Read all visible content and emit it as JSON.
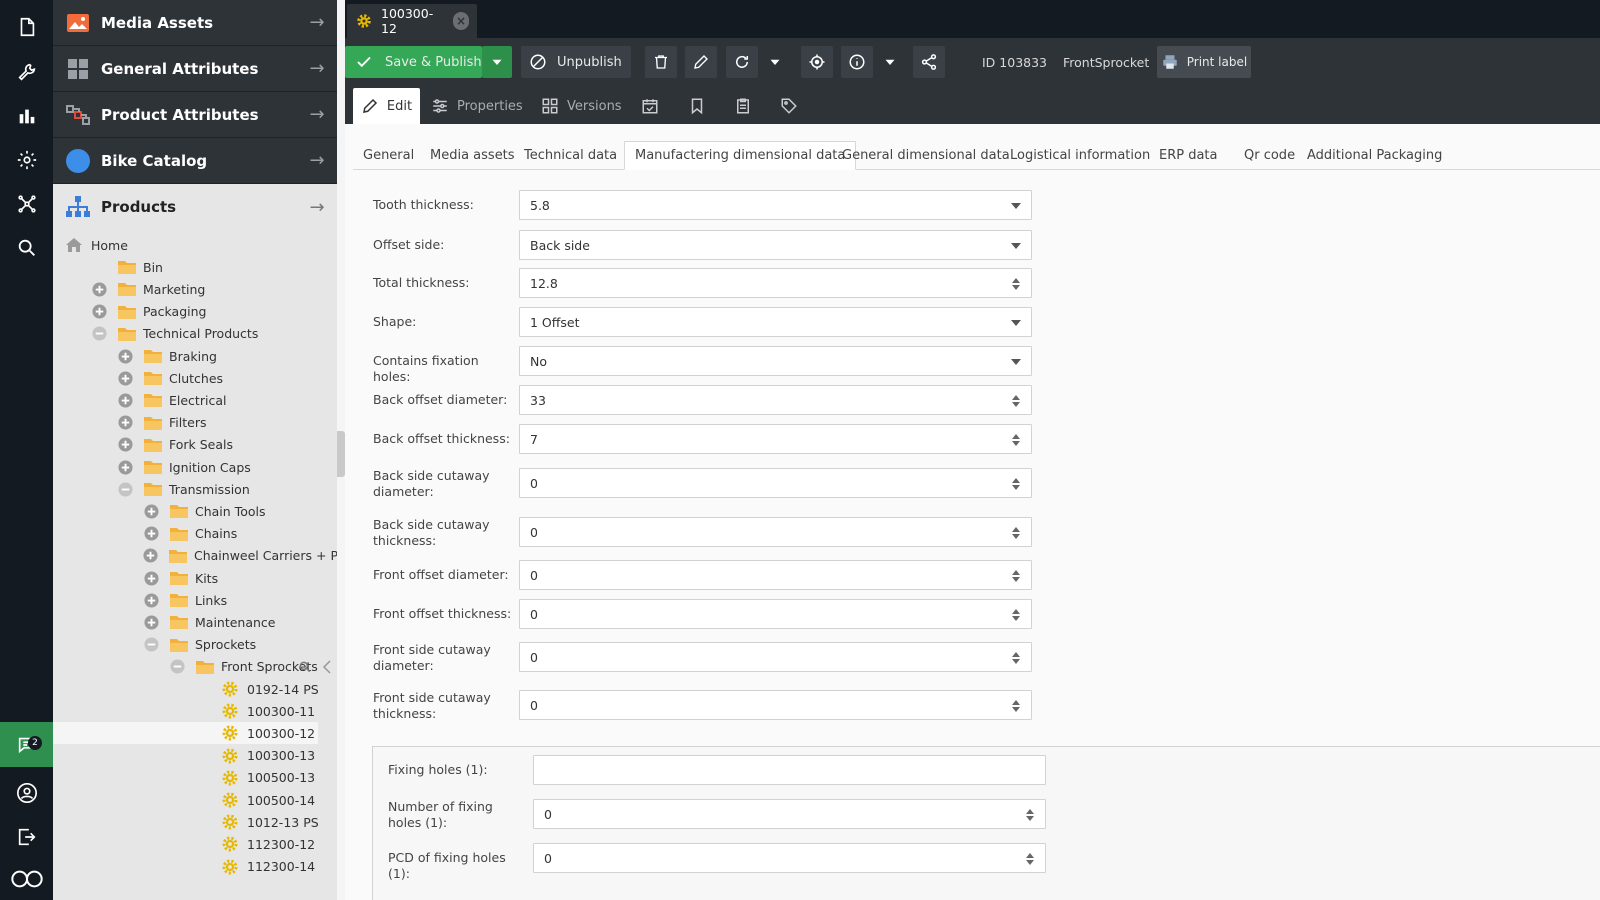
{
  "rail": {
    "chat_badge": "2",
    "icons": [
      "document-icon",
      "wrench-icon",
      "bar-chart-icon",
      "settings-icon",
      "network-icon",
      "search-icon",
      "chat-icon",
      "user-icon",
      "logout-icon",
      "infinity-logo-icon"
    ]
  },
  "nav": {
    "accordions": [
      {
        "label": "Media Assets",
        "icon": "image-icon"
      },
      {
        "label": "General Attributes",
        "icon": "grid-icon"
      },
      {
        "label": "Product Attributes",
        "icon": "attributes-icon"
      },
      {
        "label": "Bike Catalog",
        "icon": "circle-icon"
      },
      {
        "label": "Products",
        "icon": "hierarchy-icon"
      }
    ],
    "tree": [
      {
        "label": "Home",
        "level": 0,
        "type": "home",
        "toggle": "none"
      },
      {
        "label": "Bin",
        "level": 1,
        "type": "folder",
        "toggle": "none"
      },
      {
        "label": "Marketing",
        "level": 1,
        "type": "folder",
        "toggle": "plus"
      },
      {
        "label": "Packaging",
        "level": 1,
        "type": "folder",
        "toggle": "plus"
      },
      {
        "label": "Technical Products",
        "level": 1,
        "type": "folder",
        "toggle": "minus"
      },
      {
        "label": "Braking",
        "level": 2,
        "type": "folder",
        "toggle": "plus"
      },
      {
        "label": "Clutches",
        "level": 2,
        "type": "folder",
        "toggle": "plus"
      },
      {
        "label": "Electrical",
        "level": 2,
        "type": "folder",
        "toggle": "plus"
      },
      {
        "label": "Filters",
        "level": 2,
        "type": "folder",
        "toggle": "plus"
      },
      {
        "label": "Fork Seals",
        "level": 2,
        "type": "folder",
        "toggle": "plus"
      },
      {
        "label": "Ignition Caps",
        "level": 2,
        "type": "folder",
        "toggle": "plus"
      },
      {
        "label": "Transmission",
        "level": 2,
        "type": "folder",
        "toggle": "minus"
      },
      {
        "label": "Chain Tools",
        "level": 3,
        "type": "folder",
        "toggle": "plus"
      },
      {
        "label": "Chains",
        "level": 3,
        "type": "folder",
        "toggle": "plus"
      },
      {
        "label": "Chainweel Carriers + Parts",
        "level": 3,
        "type": "folder",
        "toggle": "plus"
      },
      {
        "label": "Kits",
        "level": 3,
        "type": "folder",
        "toggle": "plus"
      },
      {
        "label": "Links",
        "level": 3,
        "type": "folder",
        "toggle": "plus"
      },
      {
        "label": "Maintenance",
        "level": 3,
        "type": "folder",
        "toggle": "plus"
      },
      {
        "label": "Sprockets",
        "level": 3,
        "type": "folder",
        "toggle": "minus"
      },
      {
        "label": "Front Sprockets",
        "level": 4,
        "type": "folder",
        "toggle": "minus"
      },
      {
        "label": "0192-14 PS",
        "level": 5,
        "type": "object",
        "toggle": "none"
      },
      {
        "label": "100300-11",
        "level": 5,
        "type": "object",
        "toggle": "none"
      },
      {
        "label": "100300-12",
        "level": 5,
        "type": "object",
        "toggle": "none",
        "selected": true
      },
      {
        "label": "100300-13",
        "level": 5,
        "type": "object",
        "toggle": "none"
      },
      {
        "label": "100500-13",
        "level": 5,
        "type": "object",
        "toggle": "none"
      },
      {
        "label": "100500-14",
        "level": 5,
        "type": "object",
        "toggle": "none"
      },
      {
        "label": "1012-13 PS",
        "level": 5,
        "type": "object",
        "toggle": "none"
      },
      {
        "label": "112300-12",
        "level": 5,
        "type": "object",
        "toggle": "none"
      },
      {
        "label": "112300-14",
        "level": 5,
        "type": "object",
        "toggle": "none"
      }
    ]
  },
  "document_tab": {
    "label": "100300-12"
  },
  "toolbar": {
    "save_label": "Save & Publish",
    "unpublish_label": "Unpublish",
    "id_label": "ID 103833",
    "class_label": "FrontSprocket",
    "print_label": "Print label"
  },
  "subtabs": {
    "edit": "Edit",
    "properties": "Properties",
    "versions": "Versions"
  },
  "tabs": [
    {
      "label": "General"
    },
    {
      "label": "Media assets"
    },
    {
      "label": "Technical data"
    },
    {
      "label": "Manufactering dimensional data",
      "active": true
    },
    {
      "label": "General dimensional data"
    },
    {
      "label": "Logistical information"
    },
    {
      "label": "ERP data"
    },
    {
      "label": "Qr code"
    },
    {
      "label": "Additional Packaging"
    }
  ],
  "fields": [
    {
      "label": "Tooth thickness:",
      "value": "5.8",
      "kind": "select"
    },
    {
      "label": "Offset side:",
      "value": "Back side",
      "kind": "select"
    },
    {
      "label": "Total thickness:",
      "value": "12.8",
      "kind": "number"
    },
    {
      "label": "Shape:",
      "value": "1 Offset",
      "kind": "select"
    },
    {
      "label": "Contains fixation holes:",
      "value": "No",
      "kind": "select"
    },
    {
      "label": "Back offset diameter:",
      "value": "33",
      "kind": "number"
    },
    {
      "label": "Back offset thickness:",
      "value": "7",
      "kind": "number"
    },
    {
      "label": "Back side cutaway diameter:",
      "value": "0",
      "kind": "number"
    },
    {
      "label": "Back side cutaway thickness:",
      "value": "0",
      "kind": "number"
    },
    {
      "label": "Front offset diameter:",
      "value": "0",
      "kind": "number"
    },
    {
      "label": "Front offset thickness:",
      "value": "0",
      "kind": "number"
    },
    {
      "label": "Front side cutaway diameter:",
      "value": "0",
      "kind": "number"
    },
    {
      "label": "Front side cutaway thickness:",
      "value": "0",
      "kind": "number"
    }
  ],
  "fixing_fields": [
    {
      "label": "Fixing holes (1):",
      "value": "",
      "kind": "text"
    },
    {
      "label": "Number of fixing holes (1):",
      "value": "0",
      "kind": "number"
    },
    {
      "label": "PCD of fixing holes (1):",
      "value": "0",
      "kind": "number"
    }
  ],
  "colors": {
    "accent_green": "#35a858",
    "dark_bg": "#141a21",
    "panel_bg": "#2e3338",
    "folder": "#f2b13a",
    "gear": "#e6b800"
  }
}
